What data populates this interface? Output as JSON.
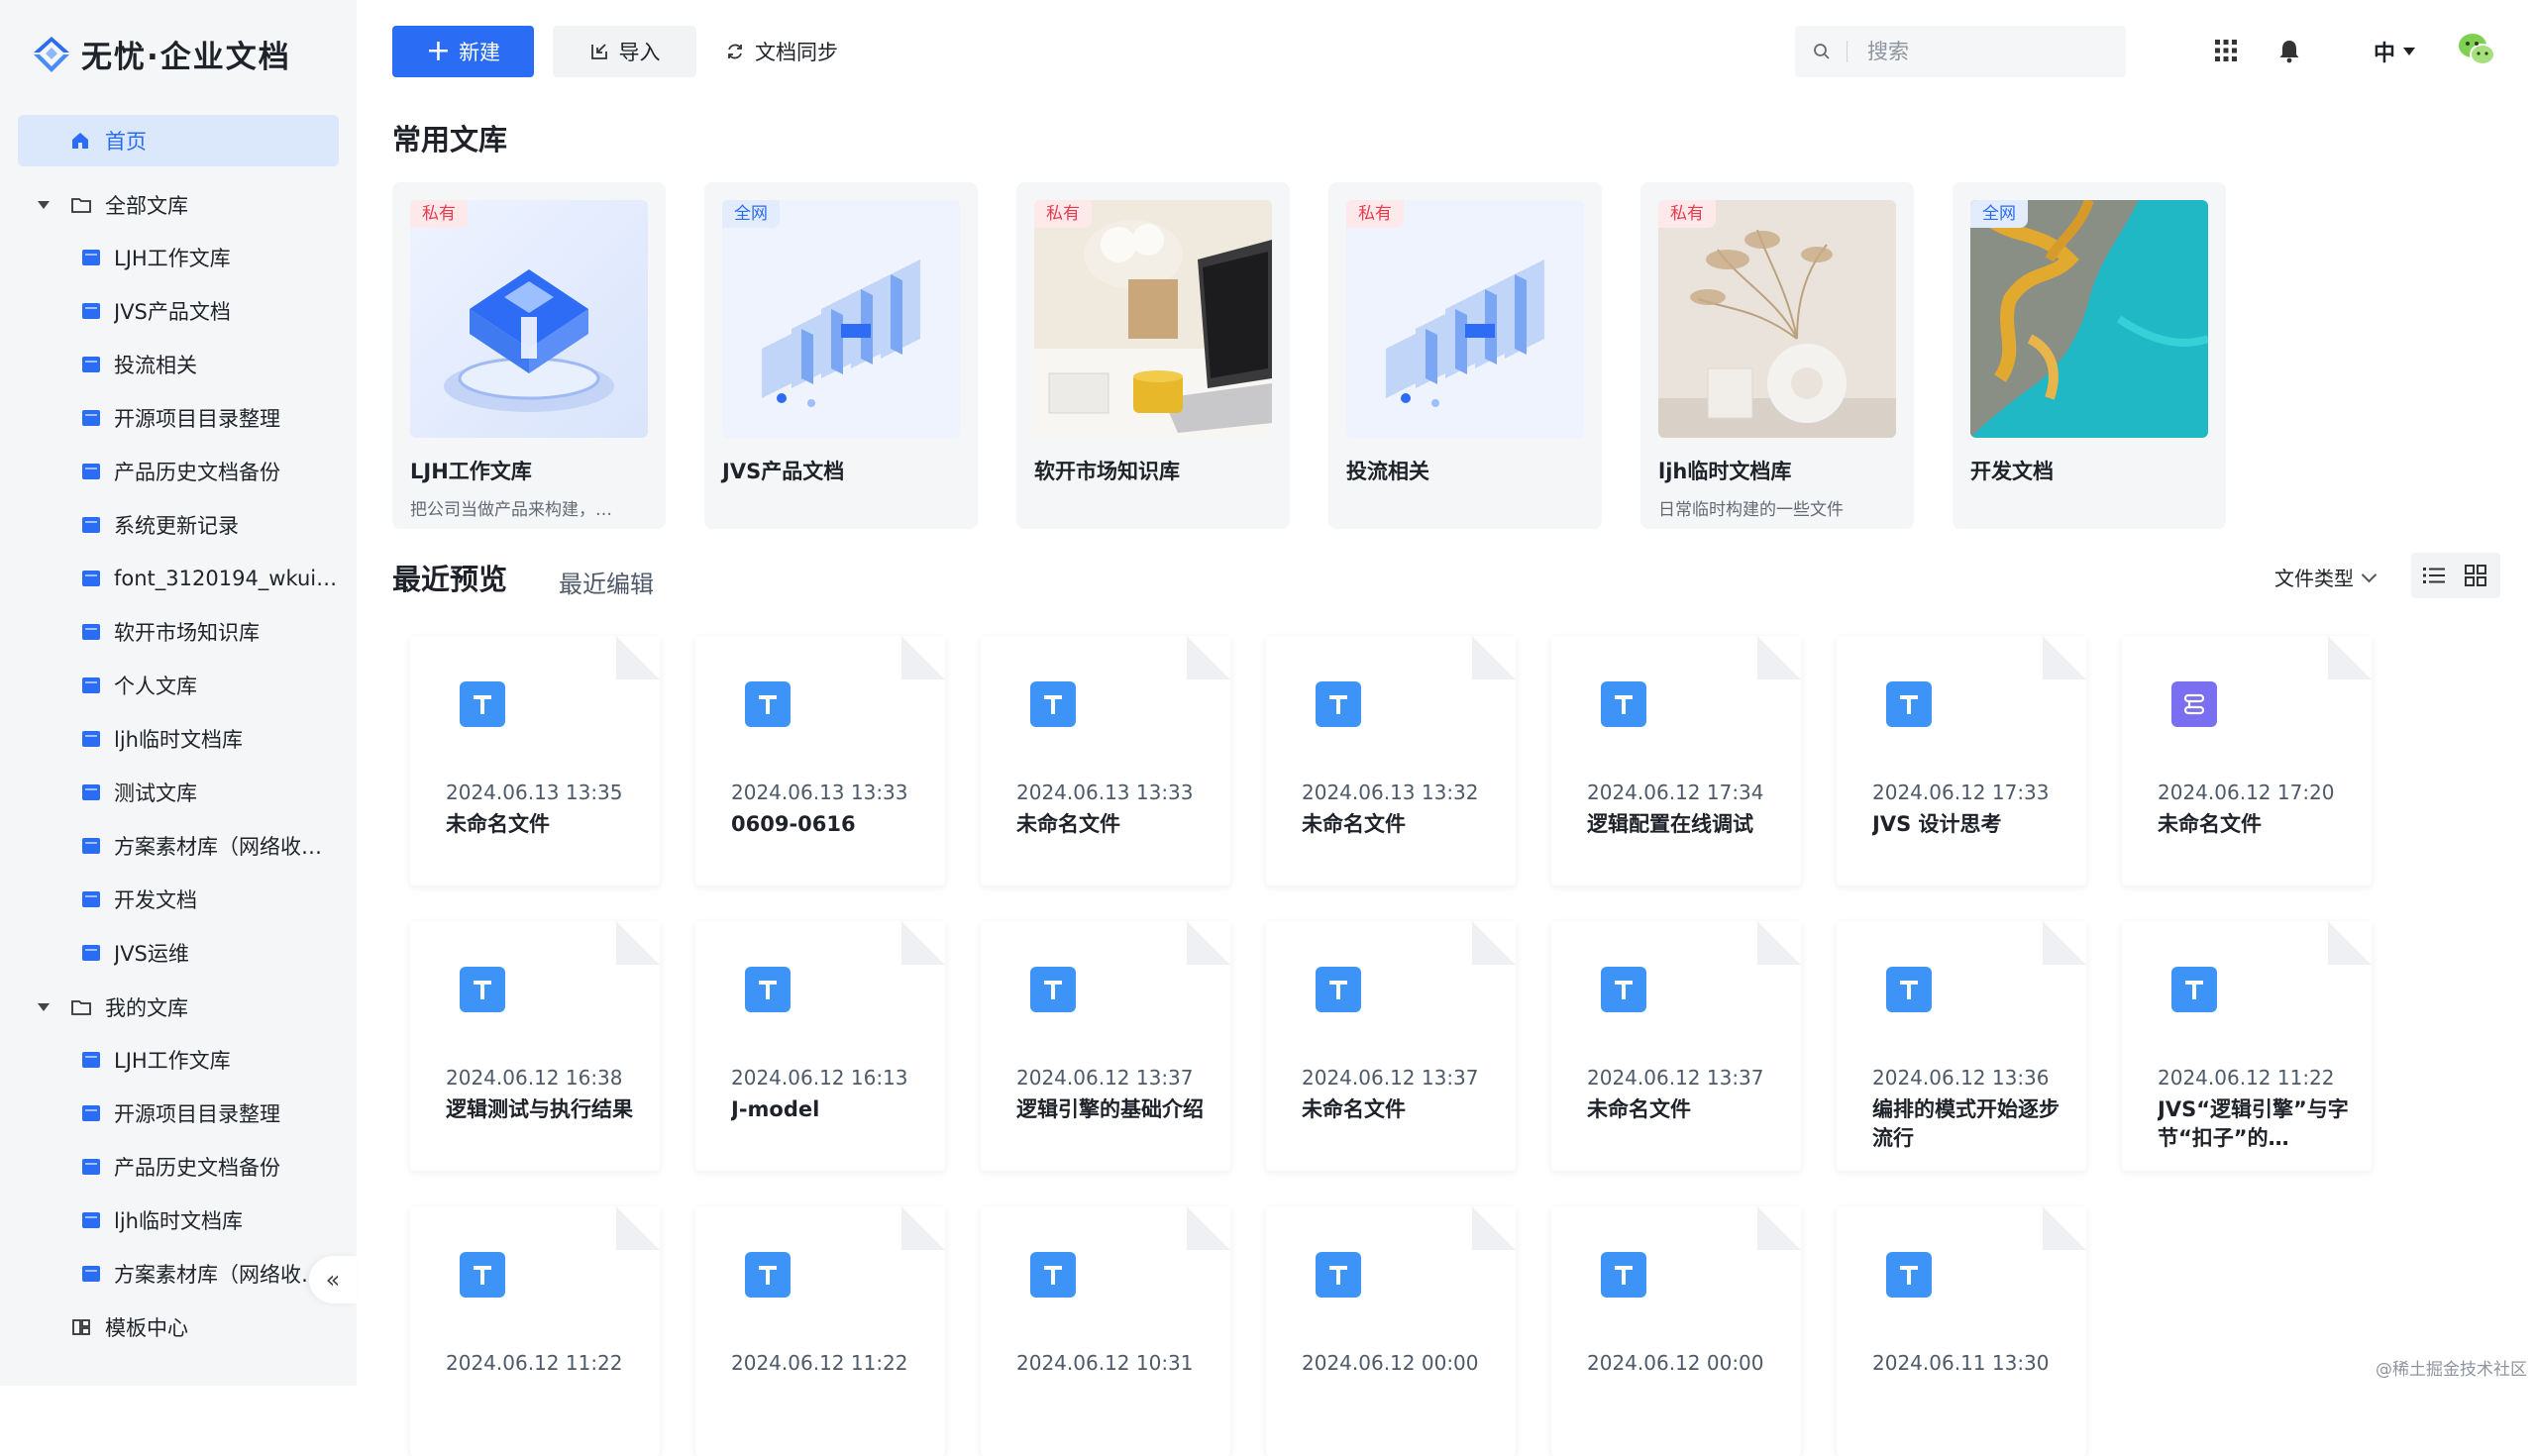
{
  "app": {
    "logo_text": "无忧·企业文档",
    "brand_color": "#2a6df4"
  },
  "sidebar": {
    "home_label": "首页",
    "all_libraries_label": "全部文库",
    "all_libraries": [
      "LJH工作文库",
      "JVS产品文档",
      "投流相关",
      "开源项目目录整理",
      "产品历史文档备份",
      "系统更新记录",
      "font_3120194_wkuip…",
      "软开市场知识库",
      "个人文库",
      "ljh临时文档库",
      "测试文库",
      "方案素材库（网络收…",
      "开发文档",
      "JVS运维"
    ],
    "my_libraries_label": "我的文库",
    "my_libraries": [
      "LJH工作文库",
      "开源项目目录整理",
      "产品历史文档备份",
      "ljh临时文档库",
      "方案素材库（网络收…"
    ],
    "template_center_label": "模板中心",
    "collapse_glyph": "«"
  },
  "toolbar": {
    "new_label": "新建",
    "import_label": "导入",
    "sync_label": "文档同步",
    "search_placeholder": "搜索",
    "lang_label": "中"
  },
  "common_libraries": {
    "title": "常用文库",
    "cards": [
      {
        "badge": "私有",
        "badge_type": "private",
        "name": "LJH工作文库",
        "desc": "把公司当做产品来构建，…",
        "cover": "cube-blue"
      },
      {
        "badge": "全网",
        "badge_type": "public",
        "name": "JVS产品文档",
        "desc": "",
        "cover": "servers"
      },
      {
        "badge": "私有",
        "badge_type": "private",
        "name": "软开市场知识库",
        "desc": "",
        "cover": "desk"
      },
      {
        "badge": "私有",
        "badge_type": "private",
        "name": "投流相关",
        "desc": "",
        "cover": "servers"
      },
      {
        "badge": "私有",
        "badge_type": "private",
        "name": "ljh临时文档库",
        "desc": "日常临时构建的一些文件",
        "cover": "vase"
      },
      {
        "badge": "全网",
        "badge_type": "public",
        "name": "开发文档",
        "desc": "",
        "cover": "aerial"
      }
    ]
  },
  "recent": {
    "tab_active": "最近预览",
    "tab_other": "最近编辑",
    "file_type_label": "文件类型",
    "docs": [
      {
        "date": "2024.06.13 13:35",
        "name": "未命名文件",
        "icon": "text-doc-icon"
      },
      {
        "date": "2024.06.13 13:33",
        "name": "0609-0616",
        "icon": "text-doc-icon"
      },
      {
        "date": "2024.06.13 13:33",
        "name": "未命名文件",
        "icon": "text-doc-icon"
      },
      {
        "date": "2024.06.13 13:32",
        "name": "未命名文件",
        "icon": "text-doc-icon"
      },
      {
        "date": "2024.06.12 17:34",
        "name": "逻辑配置在线调试",
        "icon": "text-doc-icon"
      },
      {
        "date": "2024.06.12 17:33",
        "name": "JVS 设计思考",
        "icon": "text-doc-icon"
      },
      {
        "date": "2024.06.12 17:20",
        "name": "未命名文件",
        "icon": "flow-doc-icon"
      },
      {
        "date": "2024.06.12 16:38",
        "name": "逻辑测试与执行结果",
        "icon": "text-doc-icon"
      },
      {
        "date": "2024.06.12 16:13",
        "name": "J-model",
        "icon": "text-doc-icon"
      },
      {
        "date": "2024.06.12 13:37",
        "name": "逻辑引擎的基础介绍",
        "icon": "text-doc-icon"
      },
      {
        "date": "2024.06.12 13:37",
        "name": "未命名文件",
        "icon": "text-doc-icon"
      },
      {
        "date": "2024.06.12 13:37",
        "name": "未命名文件",
        "icon": "text-doc-icon"
      },
      {
        "date": "2024.06.12 13:36",
        "name": "编排的模式开始逐步流行",
        "icon": "text-doc-icon"
      },
      {
        "date": "2024.06.12 11:22",
        "name": "JVS“逻辑引擎”与字节“扣子”的…",
        "icon": "text-doc-icon"
      },
      {
        "date": "2024.06.12 11:22",
        "name": "",
        "icon": "text-doc-icon"
      },
      {
        "date": "2024.06.12 11:22",
        "name": "",
        "icon": "text-doc-icon"
      },
      {
        "date": "2024.06.12 10:31",
        "name": "",
        "icon": "text-doc-icon"
      },
      {
        "date": "2024.06.12 00:00",
        "name": "",
        "icon": "text-doc-icon"
      },
      {
        "date": "2024.06.12 00:00",
        "name": "",
        "icon": "text-doc-icon"
      },
      {
        "date": "2024.06.11 13:30",
        "name": "",
        "icon": "text-doc-icon"
      }
    ]
  },
  "watermark": "@稀土掘金技术社区"
}
